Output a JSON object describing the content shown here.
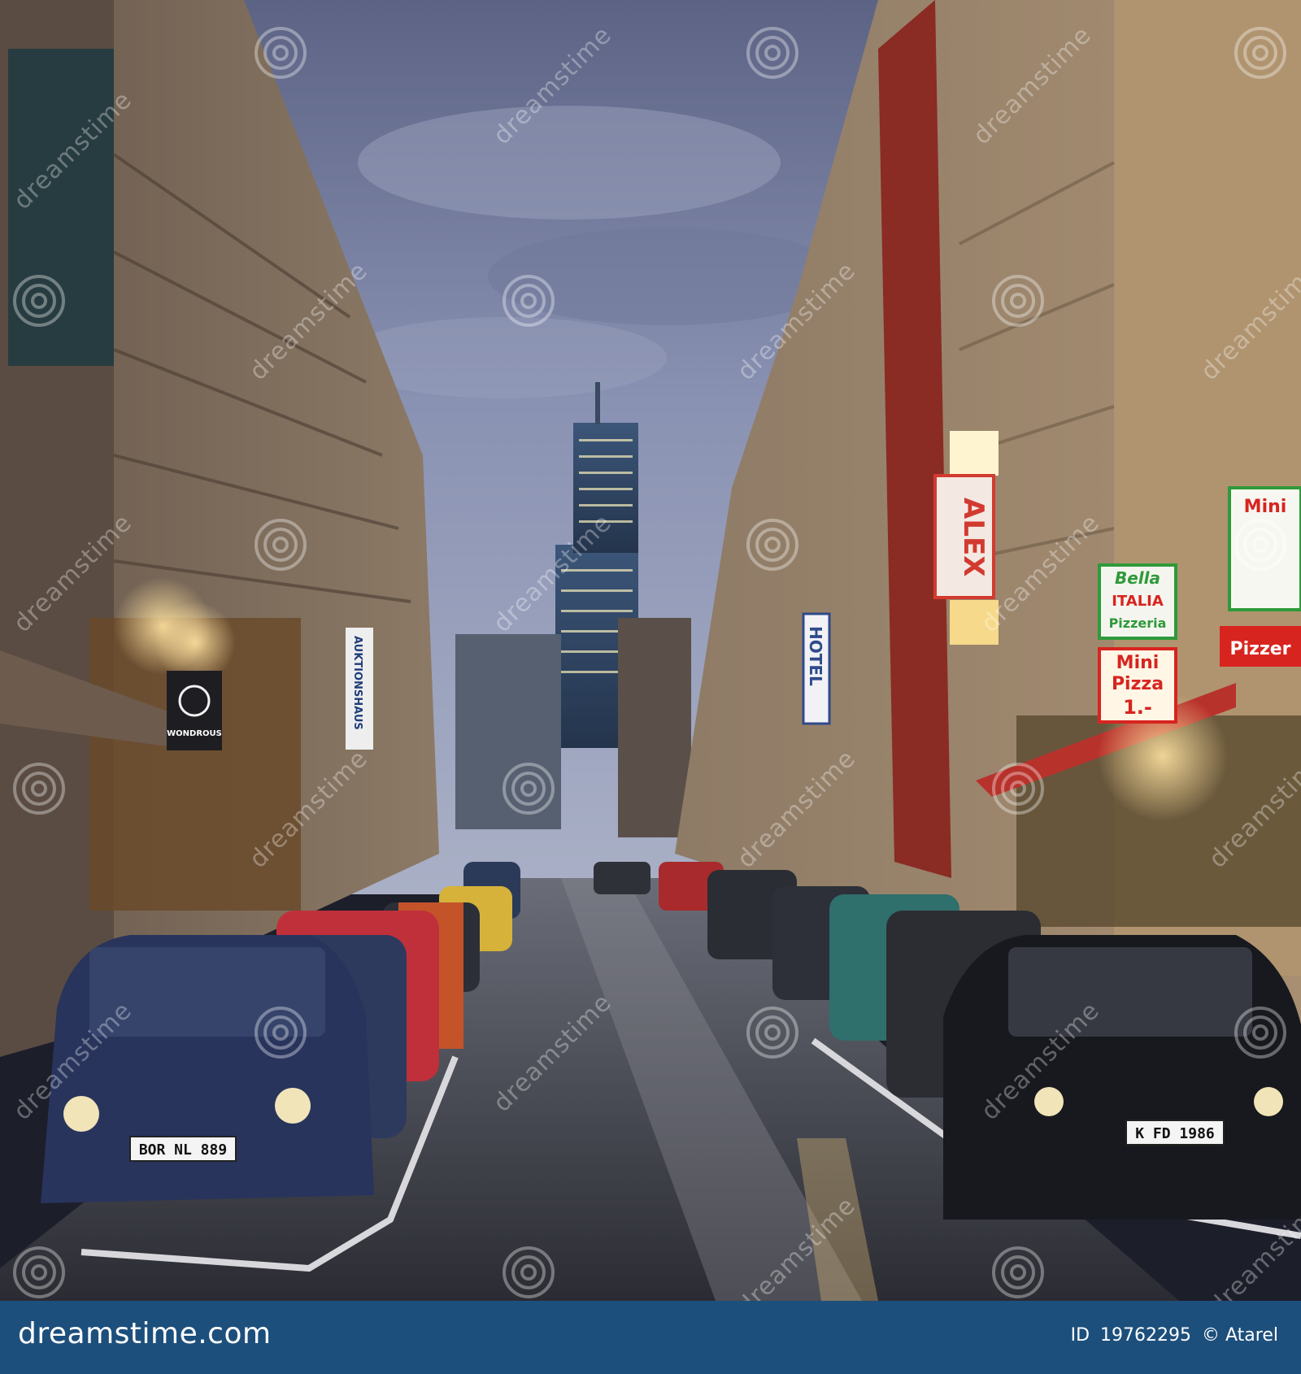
{
  "photo": {
    "signs": {
      "alex": "ALEX",
      "hotel": "HOTEL",
      "mini_pizza_line1": "Mini",
      "mini_pizza_line2": "Pizza",
      "mini_pizza_line3": "1.-",
      "bella": "Bella",
      "italia": "ITALIA",
      "pizzeria": "Pizzeria",
      "wondrous": "WONDROUS",
      "auktionshaus": "AUKTIONSHAUS",
      "mini_right": "Mini",
      "pizzer_right": "Pizzer"
    },
    "plates": {
      "left_car": "BOR NL 889",
      "right_car": "K FD 1986"
    },
    "watermark_text": "dreamstime"
  },
  "footer": {
    "logo_text": "dreamstime.com",
    "id_label": "ID",
    "id_value": "19762295",
    "credit": "© Atarel"
  },
  "colors": {
    "footer_bg": "#1d4f7c",
    "sky": "#7d86a8",
    "neon_red": "#d8241f",
    "neon_green": "#2f9a3a",
    "warm_light": "#ffd27a"
  }
}
